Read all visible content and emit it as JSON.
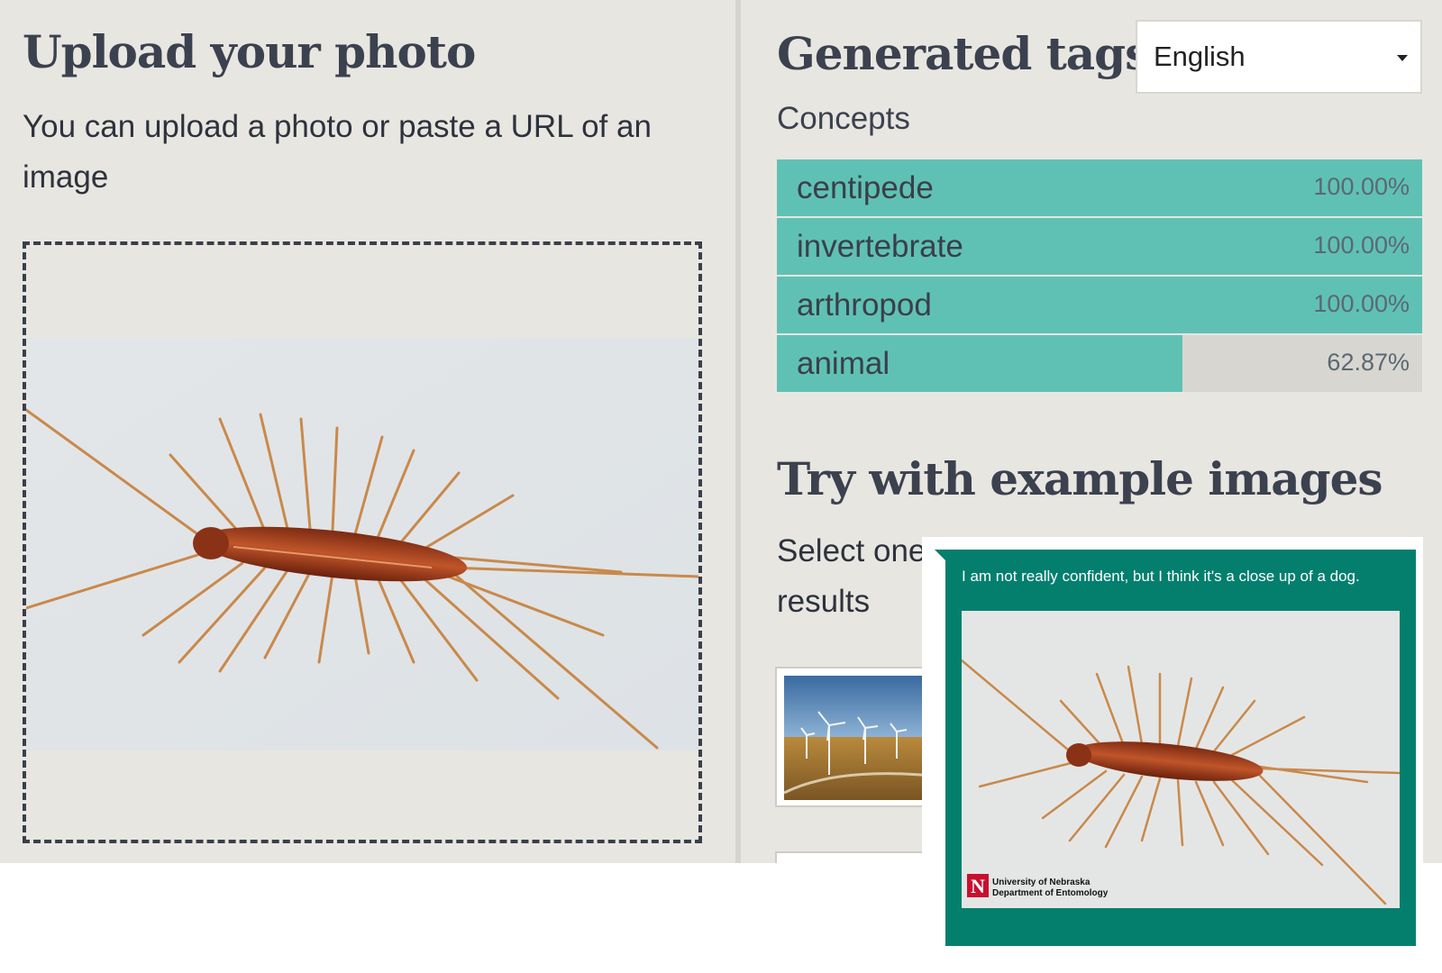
{
  "upload": {
    "title": "Upload your photo",
    "description": "You can upload a photo or paste a URL of an image"
  },
  "tags": {
    "title": "Generated tags",
    "language": {
      "selected": "English"
    },
    "concepts_label": "Concepts",
    "concepts": [
      {
        "name": "centipede",
        "value": "100.00%",
        "score": 1.0
      },
      {
        "name": "invertebrate",
        "value": "100.00%",
        "score": 1.0
      },
      {
        "name": "arthropod",
        "value": "100.00%",
        "score": 1.0
      },
      {
        "name": "animal",
        "value": "62.87%",
        "score": 0.6287
      }
    ]
  },
  "examples": {
    "title": "Try with example images",
    "description": "Select one of the following images to see the results"
  },
  "caption": {
    "text": "I am not really confident, but I think it's a close up of a dog.",
    "logo_lines": [
      "University of Nebraska",
      "Department of Entomology"
    ]
  },
  "colors": {
    "accent_teal": "#5fc1b4",
    "caption_bg": "#047f6e",
    "page_bg": "#e8e6e1"
  }
}
